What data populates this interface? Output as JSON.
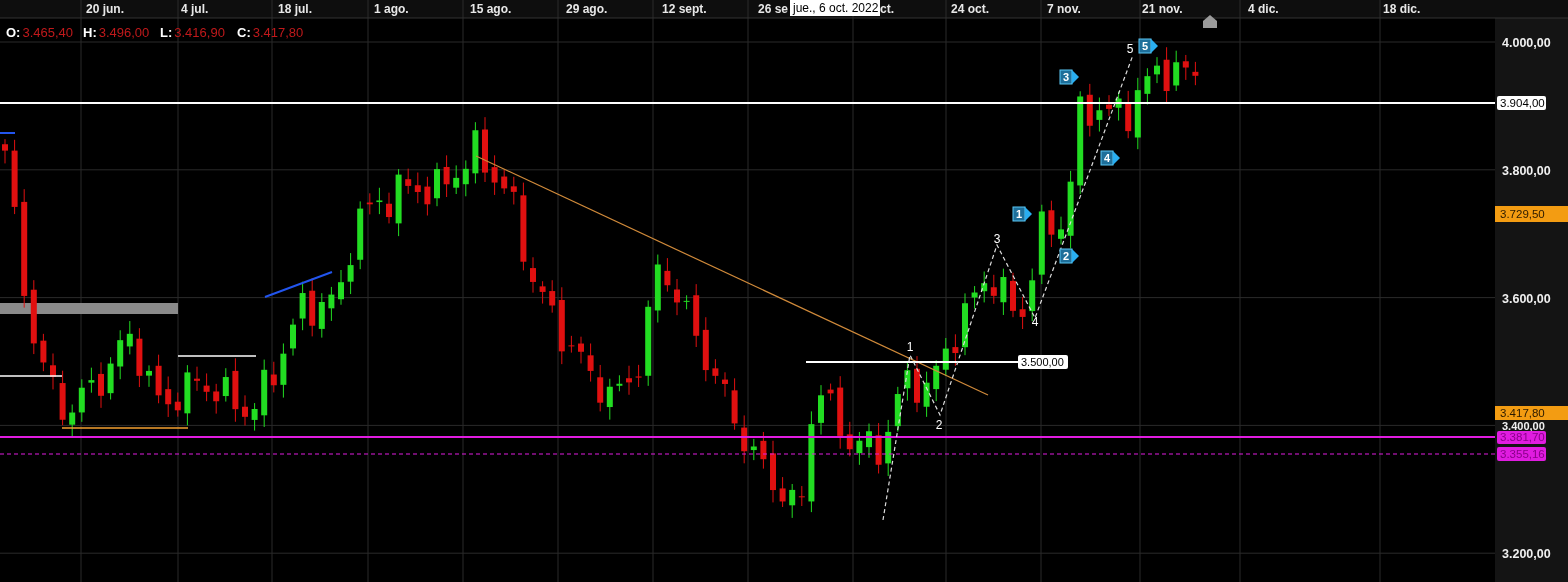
{
  "x_axis": {
    "labels": [
      "20 jun.",
      "4 jul.",
      "18 jul.",
      "1 ago.",
      "15 ago.",
      "29 ago.",
      "12 sept.",
      "26 se",
      "ct.",
      "24 oct.",
      "7 nov.",
      "21 nov.",
      "4 dic.",
      "18 dic."
    ]
  },
  "date_tooltip": "jue., 6 oct. 2022",
  "ohlc": [
    {
      "key": "O:",
      "value": "3.465,40"
    },
    {
      "key": "H:",
      "value": "3.496,00"
    },
    {
      "key": "L:",
      "value": "3.416,90"
    },
    {
      "key": "C:",
      "value": "3.417,80"
    }
  ],
  "y_axis": {
    "ticks": [
      "4.000,00",
      "3.800,00",
      "3.600,00",
      "3.400,00",
      "3.200,00"
    ]
  },
  "price_tags": [
    {
      "text": "3.904,00",
      "color": "#ffffff"
    },
    {
      "text": "3.729,50",
      "color": "#f39c12"
    },
    {
      "text": "3.417,80",
      "color": "#f39c12"
    },
    {
      "text": "3.381,70",
      "color": "#e01ce0"
    },
    {
      "text": "3.355,16",
      "color": "#e01ce0"
    }
  ],
  "level_label": "3.500,00",
  "wave_labels": [
    "1",
    "2",
    "3",
    "4",
    "5"
  ],
  "wave_markers": [
    "1",
    "2",
    "3",
    "4",
    "5"
  ]
}
